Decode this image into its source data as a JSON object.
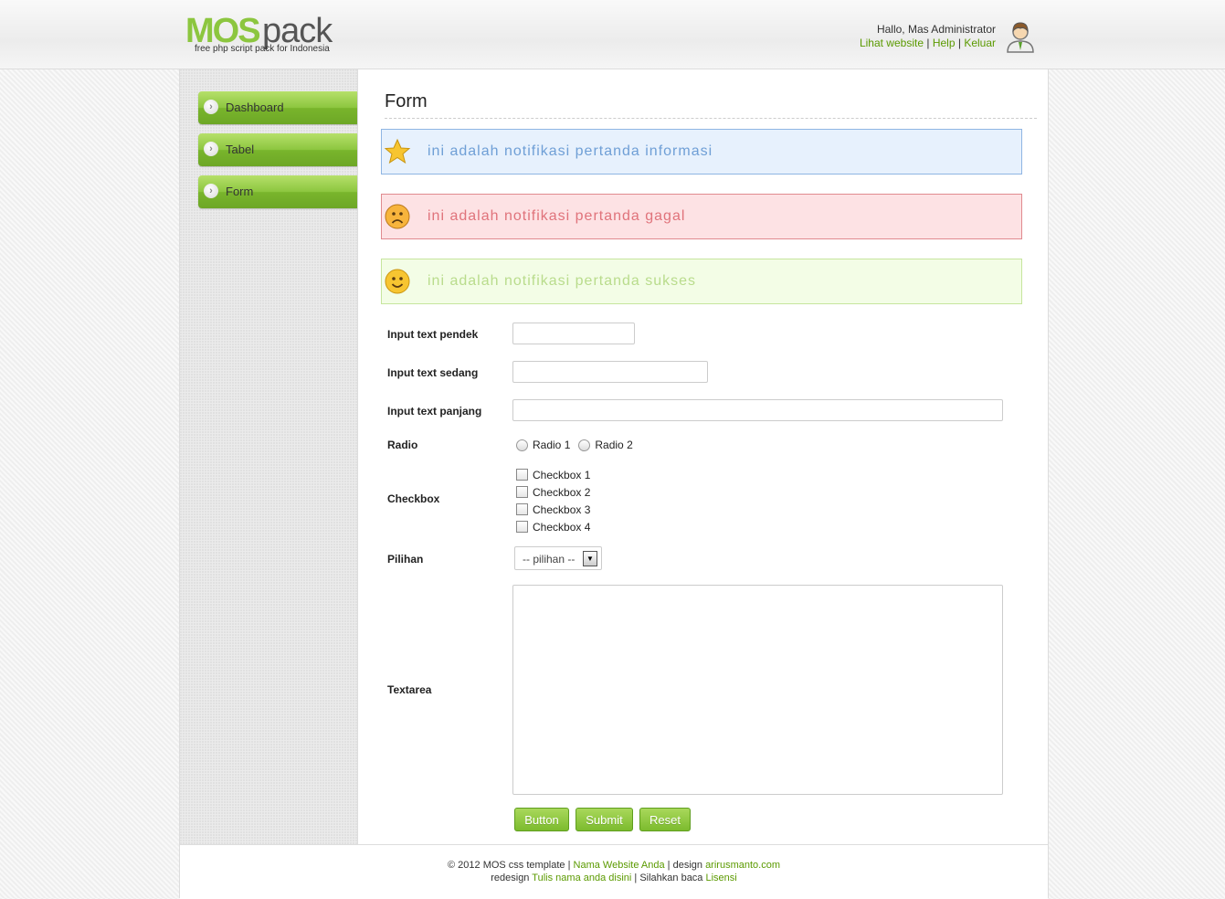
{
  "header": {
    "logo_main": "MOS",
    "logo_sub": "pack",
    "logo_tagline": "free php script pack for Indonesia",
    "greeting": "Hallo, Mas Administrator",
    "links": [
      {
        "label": "Lihat website"
      },
      {
        "label": "Help"
      },
      {
        "label": "Keluar"
      }
    ],
    "separator": "|"
  },
  "sidebar": {
    "items": [
      {
        "label": "Dashboard"
      },
      {
        "label": "Tabel"
      },
      {
        "label": "Form"
      }
    ]
  },
  "main": {
    "title": "Form",
    "notices": {
      "info": "ini adalah notifikasi pertanda informasi",
      "error": "ini adalah notifikasi pertanda gagal",
      "success": "ini adalah notifikasi pertanda sukses"
    },
    "form": {
      "short_label": "Input text pendek",
      "short_value": "",
      "medium_label": "Input text sedang",
      "medium_value": "",
      "long_label": "Input text panjang",
      "long_value": "",
      "radio_label": "Radio",
      "radios": [
        "Radio 1",
        "Radio 2"
      ],
      "checkbox_label": "Checkbox",
      "checkboxes": [
        "Checkbox 1",
        "Checkbox 2",
        "Checkbox 3",
        "Checkbox 4"
      ],
      "select_label": "Pilihan",
      "select_value": "-- pilihan --",
      "textarea_label": "Textarea",
      "textarea_value": ""
    },
    "buttons": {
      "button": "Button",
      "submit": "Submit",
      "reset": "Reset"
    }
  },
  "footer": {
    "line1_prefix": "© 2012 MOS css template |",
    "line1_link1": "Nama Website Anda",
    "line1_mid": "| design",
    "line1_link2": "arirusmanto.com",
    "line2_prefix": "redesign",
    "line2_link1": "Tulis nama anda disini",
    "line2_mid": "| Silahkan baca",
    "line2_link2": "Lisensi"
  },
  "colors": {
    "accent": "#8cc63f",
    "link": "#5b9a00",
    "info_bg": "#e7f1fd",
    "error_bg": "#fde2e4",
    "success_bg": "#f3fde6"
  }
}
